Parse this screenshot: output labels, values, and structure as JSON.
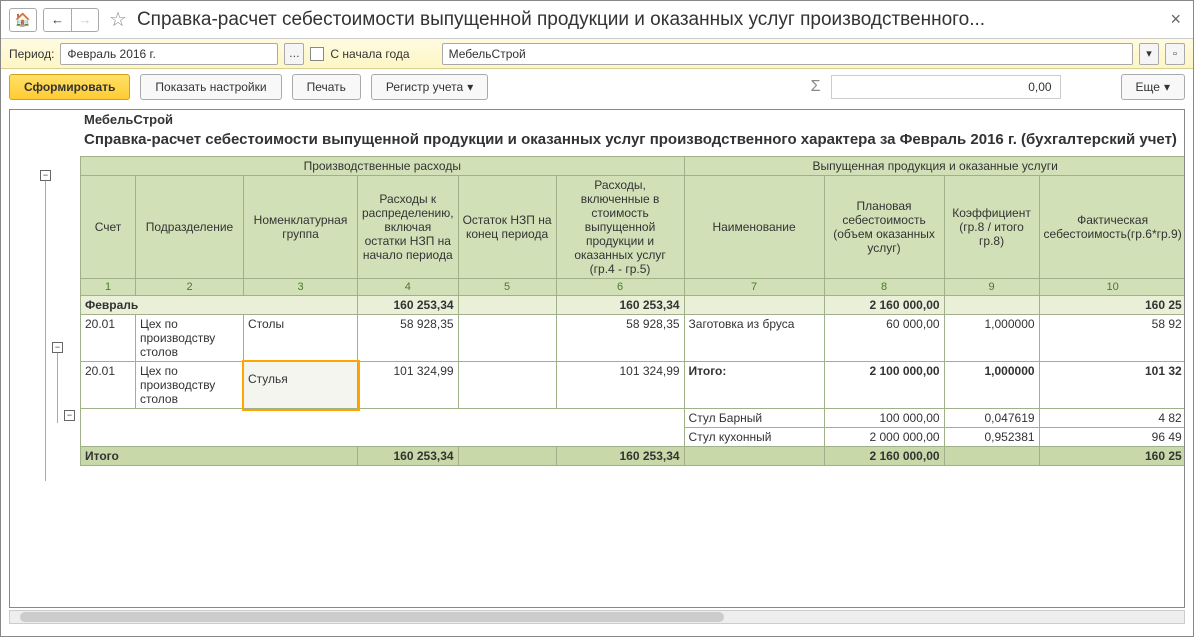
{
  "window_title": "Справка-расчет себестоимости выпущенной продукции и оказанных услуг производственного...",
  "toolbar1": {
    "period_label": "Период:",
    "period_value": "Февраль 2016 г.",
    "from_start_label": "С начала года",
    "org_value": "МебельСтрой"
  },
  "toolbar2": {
    "generate": "Сформировать",
    "show_settings": "Показать настройки",
    "print": "Печать",
    "register": "Регистр учета",
    "sum_symbol": "Σ",
    "sum_value": "0,00",
    "more": "Еще"
  },
  "report": {
    "org": "МебельСтрой",
    "title": "Справка-расчет себестоимости выпущенной продукции и оказанных услуг производственного характера  за Февраль 2016 г. (бухгалтерский учет)",
    "group1": "Производственные расходы",
    "group2": "Выпущенная  продукция и оказанные услуги",
    "cols": {
      "c1": "Счет",
      "c2": "Подразделение",
      "c3": "Номенклатурная группа",
      "c4": "Расходы к распределению, включая остатки НЗП на начало периода",
      "c5": "Остаток НЗП на конец периода",
      "c6": "Расходы, включенные в стоимость выпущенной продукции и оказанных услуг (гр.4 - гр.5)",
      "c7": "Наименование",
      "c8": "Плановая себестоимость (объем оказанных услуг)",
      "c9": "Коэффициент (гр.8 / итого гр.8)",
      "c10": "Фактическая себестоимость(гр.6*гр.9)"
    },
    "nums": {
      "n1": "1",
      "n2": "2",
      "n3": "3",
      "n4": "4",
      "n5": "5",
      "n6": "6",
      "n7": "7",
      "n8": "8",
      "n9": "9",
      "n10": "10"
    },
    "month_row": {
      "label": "Февраль",
      "c4": "160 253,34",
      "c6": "160 253,34",
      "c8": "2 160 000,00",
      "c10": "160 25"
    },
    "rows": [
      {
        "acct": "20.01",
        "dept": "Цех по производству столов",
        "grp": "Столы",
        "c4": "58 928,35",
        "c6": "58 928,35",
        "name": "Заготовка из бруса",
        "c8": "60 000,00",
        "c9": "1,000000",
        "c10": "58 92"
      },
      {
        "acct": "20.01",
        "dept": "Цех по производству столов",
        "grp": "Стулья",
        "c4": "101 324,99",
        "c6": "101 324,99",
        "name": "Итого:",
        "c8": "2 100 000,00",
        "c9": "1,000000",
        "c10": "101 32",
        "name_bold": true
      }
    ],
    "subrows": [
      {
        "name": "Стул Барный",
        "c8": "100 000,00",
        "c9": "0,047619",
        "c10": "4 82"
      },
      {
        "name": "Стул кухонный",
        "c8": "2 000 000,00",
        "c9": "0,952381",
        "c10": "96 49"
      }
    ],
    "total": {
      "label": "Итого",
      "c4": "160 253,34",
      "c6": "160 253,34",
      "c8": "2 160 000,00",
      "c10": "160 25"
    }
  }
}
